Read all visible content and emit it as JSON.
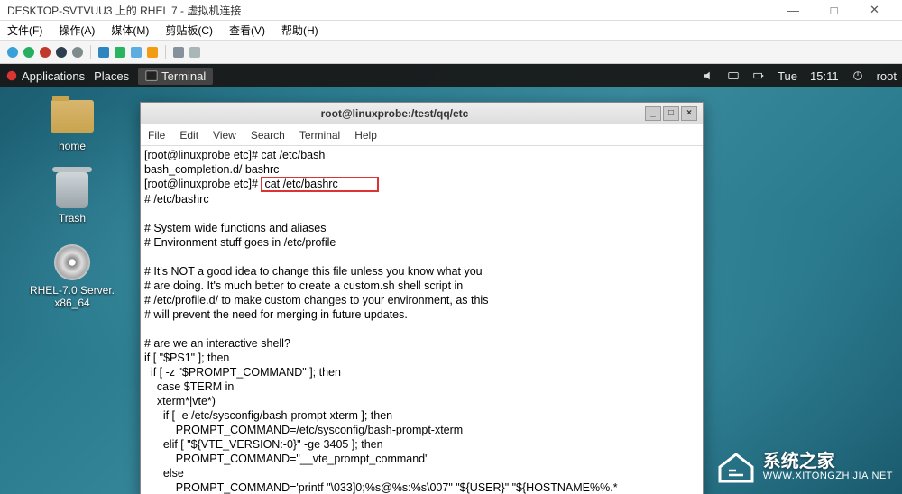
{
  "host": {
    "title": "DESKTOP-SVTVUU3 上的 RHEL 7 - 虚拟机连接",
    "buttons": {
      "min": "—",
      "max": "□",
      "close": "✕"
    },
    "menu": [
      "文件(F)",
      "操作(A)",
      "媒体(M)",
      "剪贴板(C)",
      "查看(V)",
      "帮助(H)"
    ]
  },
  "gnome": {
    "applications": "Applications",
    "places": "Places",
    "terminal": "Terminal",
    "clock_day": "Tue",
    "clock_time": "15:11",
    "user": "root"
  },
  "desktop": {
    "home": "home",
    "trash": "Trash",
    "disc_line1": "RHEL-7.0 Server.",
    "disc_line2": "x86_64"
  },
  "terminal": {
    "title": "root@linuxprobe:/test/qq/etc",
    "menu": [
      "File",
      "Edit",
      "View",
      "Search",
      "Terminal",
      "Help"
    ],
    "prompt1": "[root@linuxprobe etc]# cat /etc/bash",
    "line2": "bash_completion.d/ bashrc",
    "prompt2_prefix": "[root@linuxprobe etc]# ",
    "highlighted_cmd": "cat /etc/bashrc            ",
    "body": "# /etc/bashrc\n\n# System wide functions and aliases\n# Environment stuff goes in /etc/profile\n\n# It's NOT a good idea to change this file unless you know what you\n# are doing. It's much better to create a custom.sh shell script in\n# /etc/profile.d/ to make custom changes to your environment, as this\n# will prevent the need for merging in future updates.\n\n# are we an interactive shell?\nif [ \"$PS1\" ]; then\n  if [ -z \"$PROMPT_COMMAND\" ]; then\n    case $TERM in\n    xterm*|vte*)\n      if [ -e /etc/sysconfig/bash-prompt-xterm ]; then\n          PROMPT_COMMAND=/etc/sysconfig/bash-prompt-xterm\n      elif [ \"${VTE_VERSION:-0}\" -ge 3405 ]; then\n          PROMPT_COMMAND=\"__vte_prompt_command\"\n      else\n          PROMPT_COMMAND='printf \"\\033]0;%s@%s:%s\\007\" \"${USER}\" \"${HOSTNAME%%.*"
  },
  "watermark": {
    "name": "系统之家",
    "url": "WWW.XITONGZHIJIA.NET"
  }
}
